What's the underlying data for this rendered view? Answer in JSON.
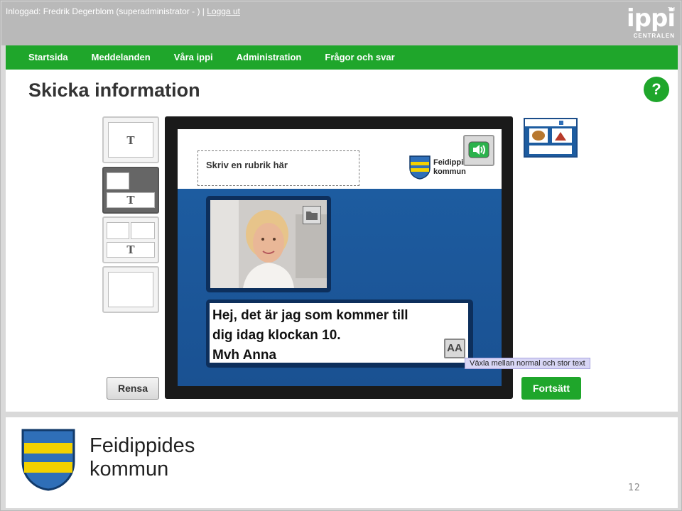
{
  "topbar": {
    "login_text": "Inloggad: Fredrik Degerblom (superadministrator - ) |",
    "logout_link": "Logga ut",
    "brand_logo": "ippi",
    "brand_tm": "TM",
    "brand_sub": "CENTRALEN"
  },
  "nav": {
    "items": [
      {
        "label": "Startsida"
      },
      {
        "label": "Meddelanden"
      },
      {
        "label": "Våra ippi"
      },
      {
        "label": "Administration"
      },
      {
        "label": "Frågor och svar"
      }
    ],
    "active": "Meddelanden",
    "color": "#1fa62b"
  },
  "page": {
    "title": "Skicka information",
    "help_label": "?"
  },
  "templates": {
    "glyph": "T",
    "selected_index": 1
  },
  "editor": {
    "headline_placeholder": "Skriv en rubrik här",
    "kommun_line1": "Feidippides",
    "kommun_line2": "kommun",
    "message_line1": "Hej, det är jag som kommer till",
    "message_line2": "dig idag klockan 10.",
    "message_line3": "Mvh Anna",
    "aa_label": "AA",
    "tooltip": "Växla mellan normal och stor text",
    "blue_color": "#1d5ca0"
  },
  "buttons": {
    "clear": "Rensa",
    "continue": "Fortsätt"
  },
  "footer": {
    "kommun_line1": "Feidippides",
    "kommun_line2": "kommun",
    "page_number": "12"
  }
}
